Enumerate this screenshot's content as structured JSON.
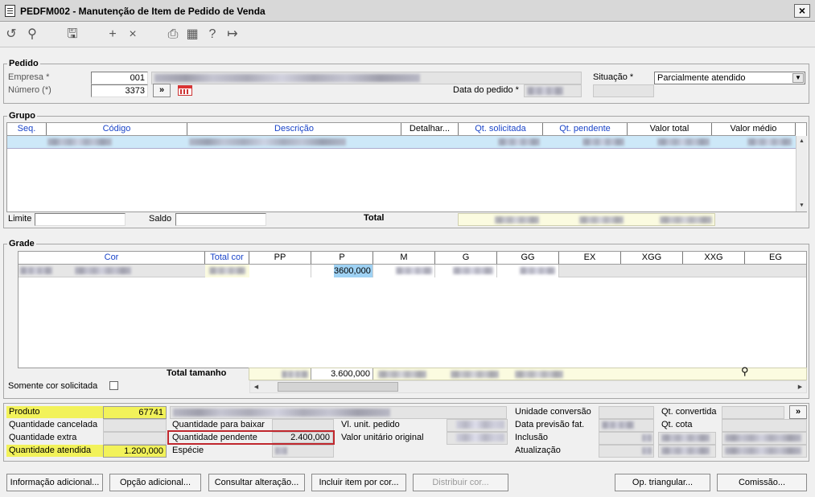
{
  "window": {
    "title": "PEDFM002 - Manutenção de Item de Pedido de Venda",
    "close": "×"
  },
  "toolbar_icons": [
    "refresh-icon",
    "search-icon",
    "save-icon",
    "add-icon",
    "delete-icon",
    "print-icon",
    "calendar-icon",
    "help-icon",
    "exit-icon"
  ],
  "toolbar_glyphs": {
    "refresh": "↺",
    "search": "⚲",
    "save": "🖫",
    "add": "+",
    "delete": "×",
    "print": "⎙",
    "calendar": "▦",
    "help": "?",
    "exit": "↦"
  },
  "pedido": {
    "title": "Pedido",
    "empresa_label": "Empresa *",
    "empresa_value": "001",
    "numero_label": "Número (*)",
    "numero_value": "3373",
    "nav_btn": "»",
    "data_label": "Data do pedido *",
    "situacao_label": "Situação *",
    "situacao_value": "Parcialmente atendido"
  },
  "grupo": {
    "title": "Grupo",
    "columns": [
      "Seq.",
      "Código",
      "Descrição",
      "Detalhar...",
      "Qt. solicitada",
      "Qt. pendente",
      "Valor total",
      "Valor médio"
    ],
    "limite_label": "Limite",
    "saldo_label": "Saldo",
    "total_label": "Total"
  },
  "grade": {
    "title": "Grade",
    "columns": [
      "Cor",
      "Total cor",
      "PP",
      "P",
      "M",
      "G",
      "GG",
      "EX",
      "XGG",
      "XXG",
      "EG"
    ],
    "row_p_value": "3600,000",
    "total_tamanho_label": "Total tamanho",
    "total_p_value": "3.600,000",
    "somente_cor_label": "Somente cor solicitada"
  },
  "detalhe": {
    "produto_label": "Produto",
    "produto_value": "67741",
    "qt_cancelada_label": "Quantidade cancelada",
    "qt_extra_label": "Quantidade extra",
    "qt_atendida_label": "Quantidade atendida",
    "qt_atendida_value": "1.200,000",
    "qt_baixar_label": "Quantidade para baixar",
    "qt_pendente_label": "Quantidade pendente",
    "qt_pendente_value": "2.400,000",
    "especie_label": "Espécie",
    "vl_unit_label": "Vl. unit. pedido",
    "vl_unit_orig_label": "Valor unitário original",
    "unidade_conv_label": "Unidade conversão",
    "data_prev_label": "Data previsão fat.",
    "inclusao_label": "Inclusão",
    "atualizacao_label": "Atualização",
    "qt_convertida_label": "Qt. convertida",
    "qt_cota_label": "Qt. cota",
    "nav_btn": "»"
  },
  "buttons": {
    "info": "Informação adicional...",
    "opcao": "Opção adicional...",
    "consultar": "Consultar alteração...",
    "incluir": "Incluir item por cor...",
    "distribuir": "Distribuir cor...",
    "triangular": "Op. triangular...",
    "comissao": "Comissão..."
  },
  "colors": {
    "highlight_yellow": "#f2f25a",
    "pendente_border": "#c0272d",
    "header_blue": "#1a44c8",
    "selection": "#cde8f8"
  }
}
